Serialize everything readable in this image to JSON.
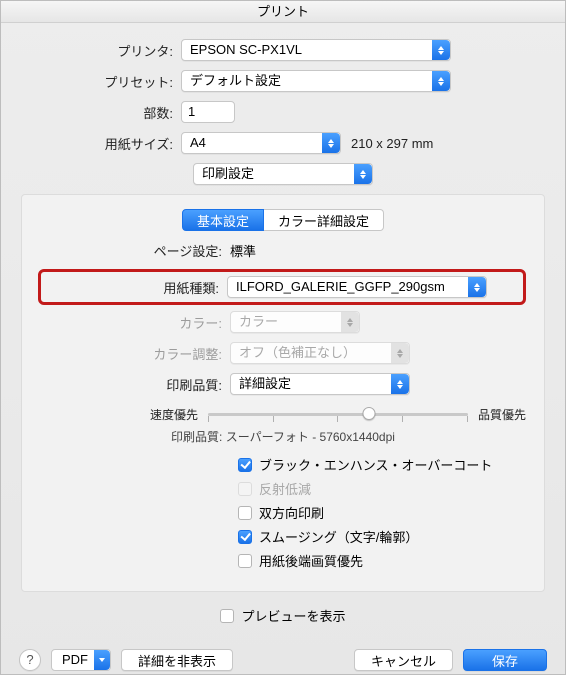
{
  "title": "プリント",
  "top": {
    "printer_label": "プリンタ:",
    "printer_value": "EPSON SC-PX1VL",
    "preset_label": "プリセット:",
    "preset_value": "デフォルト設定",
    "copies_label": "部数:",
    "copies_value": "1",
    "papersize_label": "用紙サイズ:",
    "papersize_value": "A4",
    "papersize_hint": "210 x 297 mm",
    "section_value": "印刷設定"
  },
  "tabs": {
    "basic": "基本設定",
    "advanced": "カラー詳細設定"
  },
  "panel": {
    "page_setup_label": "ページ設定:",
    "page_setup_value": "標準",
    "media_label": "用紙種類:",
    "media_value": "ILFORD_GALERIE_GGFP_290gsm",
    "color_label": "カラー:",
    "color_value": "カラー",
    "color_adj_label": "カラー調整:",
    "color_adj_value": "オフ（色補正なし）",
    "quality_label": "印刷品質:",
    "quality_value": "詳細設定",
    "slider_left": "速度優先",
    "slider_right": "品質優先",
    "quality_info": "印刷品質: スーパーフォト - 5760x1440dpi",
    "checks": {
      "black_enhance": "ブラック・エンハンス・オーバーコート",
      "reflection": "反射低減",
      "bidirectional": "双方向印刷",
      "smoothing": "スムージング（文字/輪郭）",
      "trailing": "用紙後端画質優先"
    }
  },
  "preview_label": "プレビューを表示",
  "footer": {
    "pdf": "PDF",
    "details": "詳細を非表示",
    "cancel": "キャンセル",
    "save": "保存"
  }
}
